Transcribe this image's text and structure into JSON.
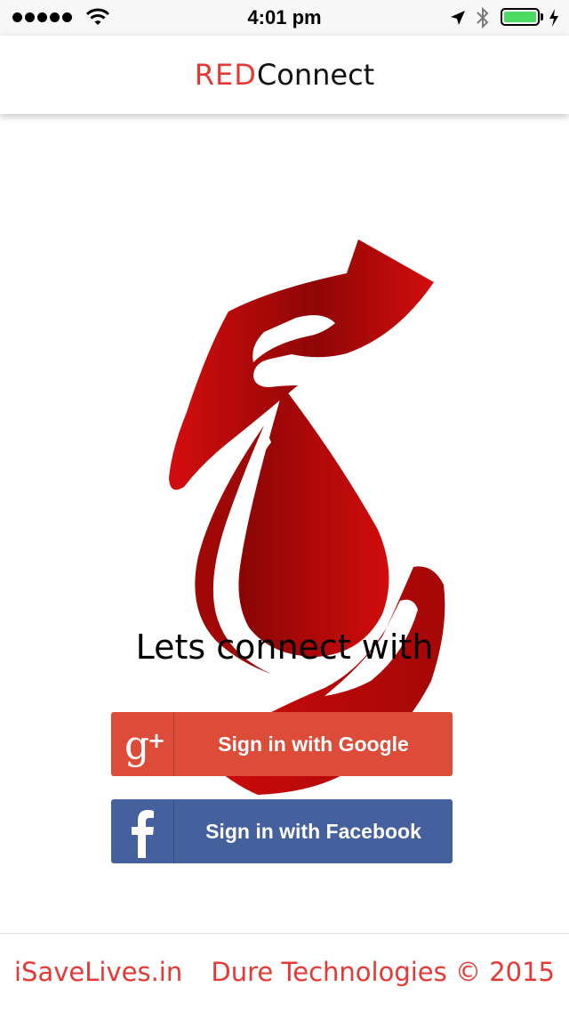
{
  "status_bar": {
    "time": "4:01 pm",
    "battery_level": 1.0,
    "icons": [
      "signal-dots-icon",
      "wifi-icon",
      "location-arrow-icon",
      "bluetooth-icon",
      "battery-icon",
      "charging-icon"
    ]
  },
  "header": {
    "brand_prefix": "RED",
    "brand_suffix": "Connect"
  },
  "main": {
    "logo_icon": "blood-drop-hands-logo",
    "prompt": "Lets connect with",
    "google_button": {
      "label": "Sign in with Google",
      "icon": "google-plus-icon",
      "color": "#dd4b39"
    },
    "facebook_button": {
      "label": "Sign in with Facebook",
      "icon": "facebook-icon",
      "color": "#3b5998"
    }
  },
  "footer": {
    "left_link": "iSaveLives.in",
    "right_text": "Dure Technologies © 2015"
  },
  "colors": {
    "accent": "#e53935",
    "logo_red": "#cc0a0a",
    "logo_dark": "#8a0505"
  }
}
